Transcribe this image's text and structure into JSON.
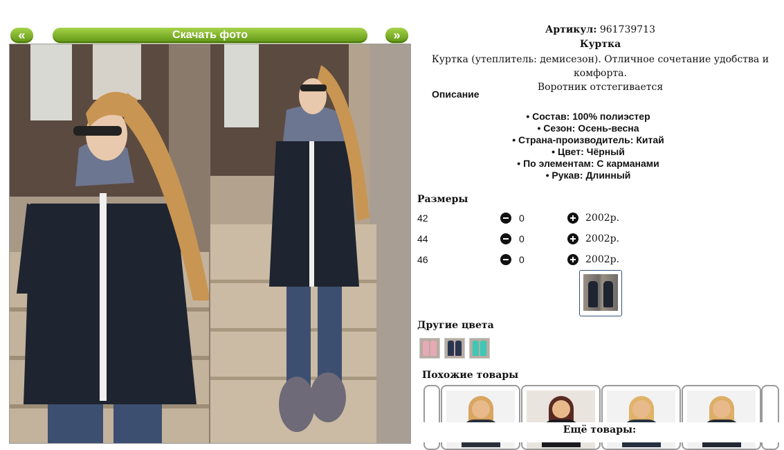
{
  "gallery": {
    "prev_label": "«",
    "next_label": "»",
    "download_label": "Скачать фото"
  },
  "product": {
    "article_label": "Артикул:",
    "article_value": "961739713",
    "name": "Куртка",
    "description_line1": "Куртка (утеплитель: демисезон). Отличное сочетание удобства и комфорта.",
    "description_line2": "Воротник отстегивается"
  },
  "description": {
    "title": "Описание",
    "specs": [
      "Состав: 100% полиэстер",
      "Сезон: Осень-весна",
      "Страна-производитель: Китай",
      "Цвет: Чёрный",
      "По элементам: С карманами",
      "Рукав: Длинный"
    ]
  },
  "sizes": {
    "title": "Размеры",
    "rows": [
      {
        "size": "42",
        "qty": "0",
        "price": "2002р."
      },
      {
        "size": "44",
        "qty": "0",
        "price": "2002р."
      },
      {
        "size": "46",
        "qty": "0",
        "price": "2002р."
      }
    ]
  },
  "other_colors": {
    "title": "Другие цвета",
    "items": [
      "pink",
      "navy",
      "mint"
    ]
  },
  "similar": {
    "title": "Похожие товары"
  },
  "more": {
    "title": "Ещё товары:"
  },
  "colors": {
    "button_green": "#6ea91f",
    "thumb_border": "#31527a",
    "jacket": "#1e2430"
  }
}
